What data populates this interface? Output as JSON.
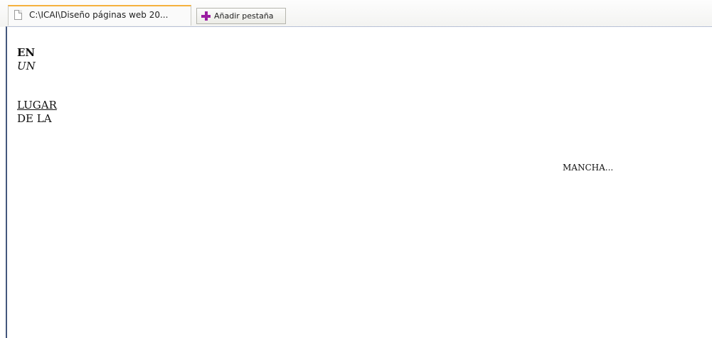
{
  "tabs": {
    "active_title": "C:\\ICAI\\Diseño páginas web 20...",
    "page_icon": "page-icon",
    "add_label": "Añadir pestaña",
    "add_icon": "plus-icon",
    "accent_color": "#f5b13d",
    "plus_color": "#9b1fa1"
  },
  "document": {
    "line1": "EN",
    "line2": "UN",
    "line3": "LUGAR",
    "line4": "DE LA",
    "right_text": "MANCHA..."
  }
}
